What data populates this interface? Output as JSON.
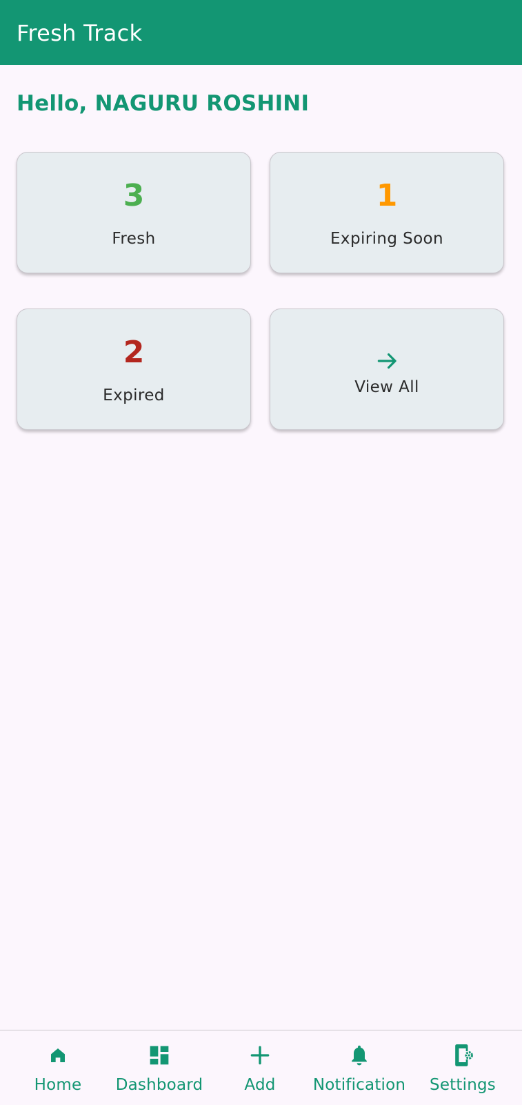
{
  "app_bar": {
    "title": "Fresh Track"
  },
  "greeting": "Hello, NAGURU ROSHINI",
  "cards": {
    "fresh": {
      "count": "3",
      "label": "Fresh",
      "color": "#4caf50"
    },
    "expiring": {
      "count": "1",
      "label": "Expiring Soon",
      "color": "#ff9800"
    },
    "expired": {
      "count": "2",
      "label": "Expired",
      "color": "#b3261e"
    },
    "view_all": {
      "label": "View All",
      "icon": "arrow-forward-icon"
    }
  },
  "bottom_nav": {
    "items": [
      {
        "label": "Home",
        "icon": "home-icon"
      },
      {
        "label": "Dashboard",
        "icon": "dashboard-icon"
      },
      {
        "label": "Add",
        "icon": "add-icon"
      },
      {
        "label": "Notification",
        "icon": "bell-icon"
      },
      {
        "label": "Settings",
        "icon": "settings-phone-icon"
      }
    ]
  },
  "colors": {
    "primary": "#139673",
    "background": "#fcf6fd",
    "card": "#e7edf0"
  }
}
